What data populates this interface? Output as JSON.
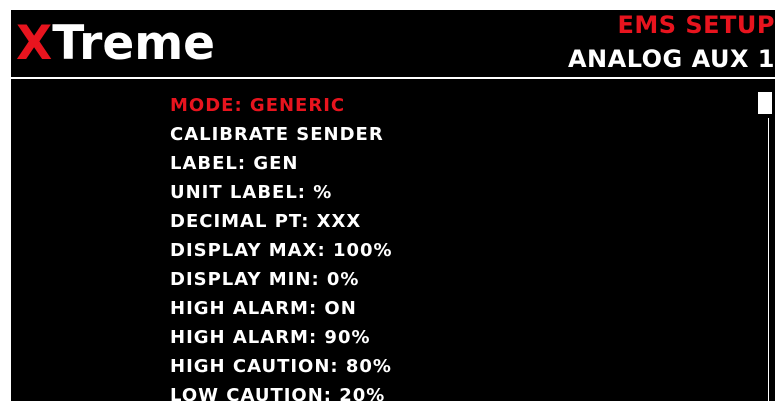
{
  "header": {
    "brand_x": "X",
    "brand_rest": "Treme",
    "category": "EMS SETUP",
    "title": "ANALOG AUX 1"
  },
  "menu": {
    "selected_index": 0,
    "items": [
      "MODE: GENERIC",
      "CALIBRATE SENDER",
      "LABEL: GEN",
      "UNIT LABEL: %",
      "DECIMAL PT: XXX",
      "DISPLAY MAX: 100%",
      "DISPLAY MIN: 0%",
      "HIGH ALARM: ON",
      "HIGH ALARM: 90%",
      "HIGH CAUTION: 80%",
      "LOW CAUTION: 20%"
    ]
  },
  "scrollbar": {
    "position_fraction": 0.0
  },
  "colors": {
    "background": "#000000",
    "text": "#ffffff",
    "accent": "#e8141e"
  }
}
